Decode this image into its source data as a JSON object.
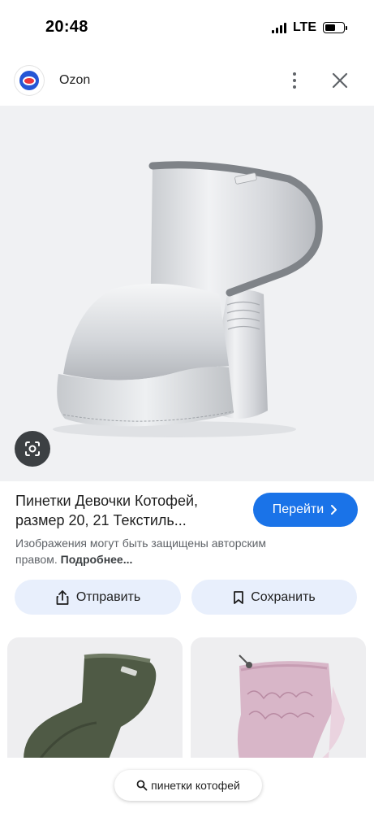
{
  "status_bar": {
    "time": "20:48",
    "network": "LTE",
    "battery_level": 0.55
  },
  "header": {
    "site_name": "Ozon",
    "logo_icon": "ozon-logo",
    "more_icon": "more-vert-icon",
    "close_icon": "close-icon"
  },
  "main_image": {
    "lens_icon": "lens-icon"
  },
  "result": {
    "title": "Пинетки Девочки Котофей, размер 20, 21 Текстиль...",
    "visit_label": "Перейти",
    "copyright_text": "Изображения могут быть защищены авторским правом.",
    "learn_more": "Подробнее..."
  },
  "actions": {
    "share_label": "Отправить",
    "save_label": "Сохранить"
  },
  "search": {
    "query": "пинетки котофей"
  },
  "colors": {
    "accent": "#1a73e8",
    "action_bg": "#e8effc"
  }
}
